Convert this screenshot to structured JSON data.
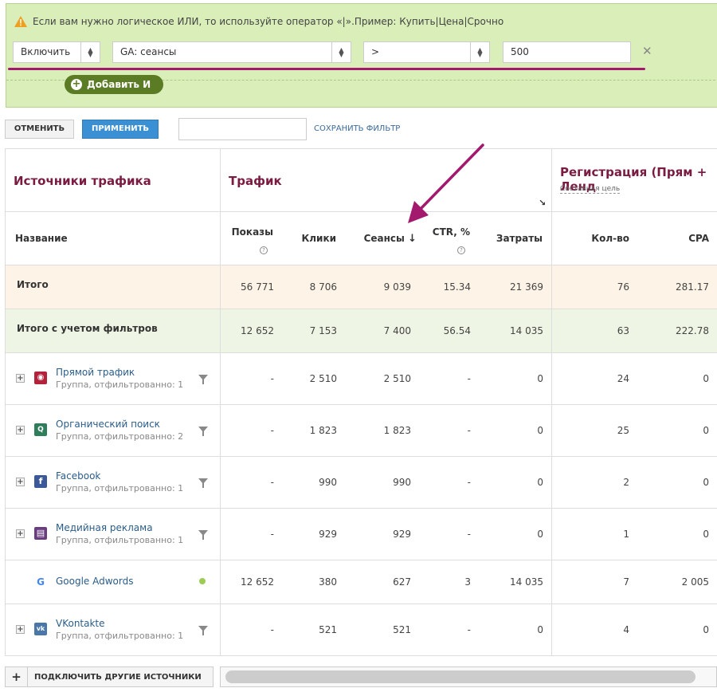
{
  "filter": {
    "hint": "Если вам нужно логическое ИЛИ, то используйте оператор «|».Пример: Купить|Цена|Срочно",
    "include_value": "Включить",
    "metric_value": "GA: сеансы",
    "operator_value": ">",
    "threshold_value": "500",
    "add_and_label": "Добавить И"
  },
  "actions": {
    "cancel_label": "ОТМЕНИТЬ",
    "apply_label": "ПРИМЕНИТЬ",
    "save_filter_label": "СОХРАНИТЬ ФИЛЬТР"
  },
  "table": {
    "group_sources": "Источники трафика",
    "group_traffic": "Трафик",
    "group_registration": "Регистрация (Прям + Ленд",
    "group_registration_sub": "Составная цель",
    "col_name": "Название",
    "col_impressions": "Показы",
    "col_clicks": "Клики",
    "col_sessions": "Сеансы",
    "col_ctr": "CTR, %",
    "col_costs": "Затраты",
    "col_count": "Кол-во",
    "col_cpa": "CPA",
    "total": {
      "label": "Итого",
      "impressions": "56 771",
      "clicks": "8 706",
      "sessions": "9 039",
      "ctr": "15.34",
      "costs": "21 369",
      "count": "76",
      "cpa": "281.17"
    },
    "filtered_total": {
      "label": "Итого с учетом фильтров",
      "impressions": "12 652",
      "clicks": "7 153",
      "sessions": "7 400",
      "ctr": "56.54",
      "costs": "14 035",
      "count": "63",
      "cpa": "222.78"
    },
    "rows": [
      {
        "name": "Прямой трафик",
        "sub": "Группа, отфильтрованно: 1",
        "icon": "direct-traffic-icon",
        "color": "#b3213a",
        "impressions": "-",
        "clicks": "2 510",
        "sessions": "2 510",
        "ctr": "-",
        "costs": "0",
        "count": "24",
        "cpa": "0"
      },
      {
        "name": "Органический поиск",
        "sub": "Группа, отфильтрованно: 2",
        "icon": "organic-search-icon",
        "color": "#2e7d5b",
        "impressions": "-",
        "clicks": "1 823",
        "sessions": "1 823",
        "ctr": "-",
        "costs": "0",
        "count": "25",
        "cpa": "0"
      },
      {
        "name": "Facebook",
        "sub": "Группа, отфильтрованно: 1",
        "icon": "facebook-icon",
        "color": "#3b5998",
        "impressions": "-",
        "clicks": "990",
        "sessions": "990",
        "ctr": "-",
        "costs": "0",
        "count": "2",
        "cpa": "0"
      },
      {
        "name": "Медийная реклама",
        "sub": "Группа, отфильтрованно: 1",
        "icon": "display-ads-icon",
        "color": "#6a3d80",
        "impressions": "-",
        "clicks": "929",
        "sessions": "929",
        "ctr": "-",
        "costs": "0",
        "count": "1",
        "cpa": "0"
      },
      {
        "name": "Google Adwords",
        "sub": "",
        "icon": "google-icon",
        "color": "#4285f4",
        "impressions": "12 652",
        "clicks": "380",
        "sessions": "627",
        "ctr": "3",
        "costs": "14 035",
        "count": "7",
        "cpa": "2 005"
      },
      {
        "name": "VKontakte",
        "sub": "Группа, отфильтрованно: 1",
        "icon": "vk-icon",
        "color": "#4a76a8",
        "impressions": "-",
        "clicks": "521",
        "sessions": "521",
        "ctr": "-",
        "costs": "0",
        "count": "4",
        "cpa": "0"
      }
    ]
  },
  "footer": {
    "connect_label": "ПОДКЛЮЧИТЬ ДРУГИЕ ИСТОЧНИКИ"
  },
  "colors": {
    "filter_bg": "#d9eeb8",
    "accent_magenta": "#a2196e",
    "header_maroon": "#7a1b42",
    "apply_blue": "#3b8fd3",
    "total_bg": "#fdf3e7",
    "filtered_bg": "#eef5e4"
  }
}
